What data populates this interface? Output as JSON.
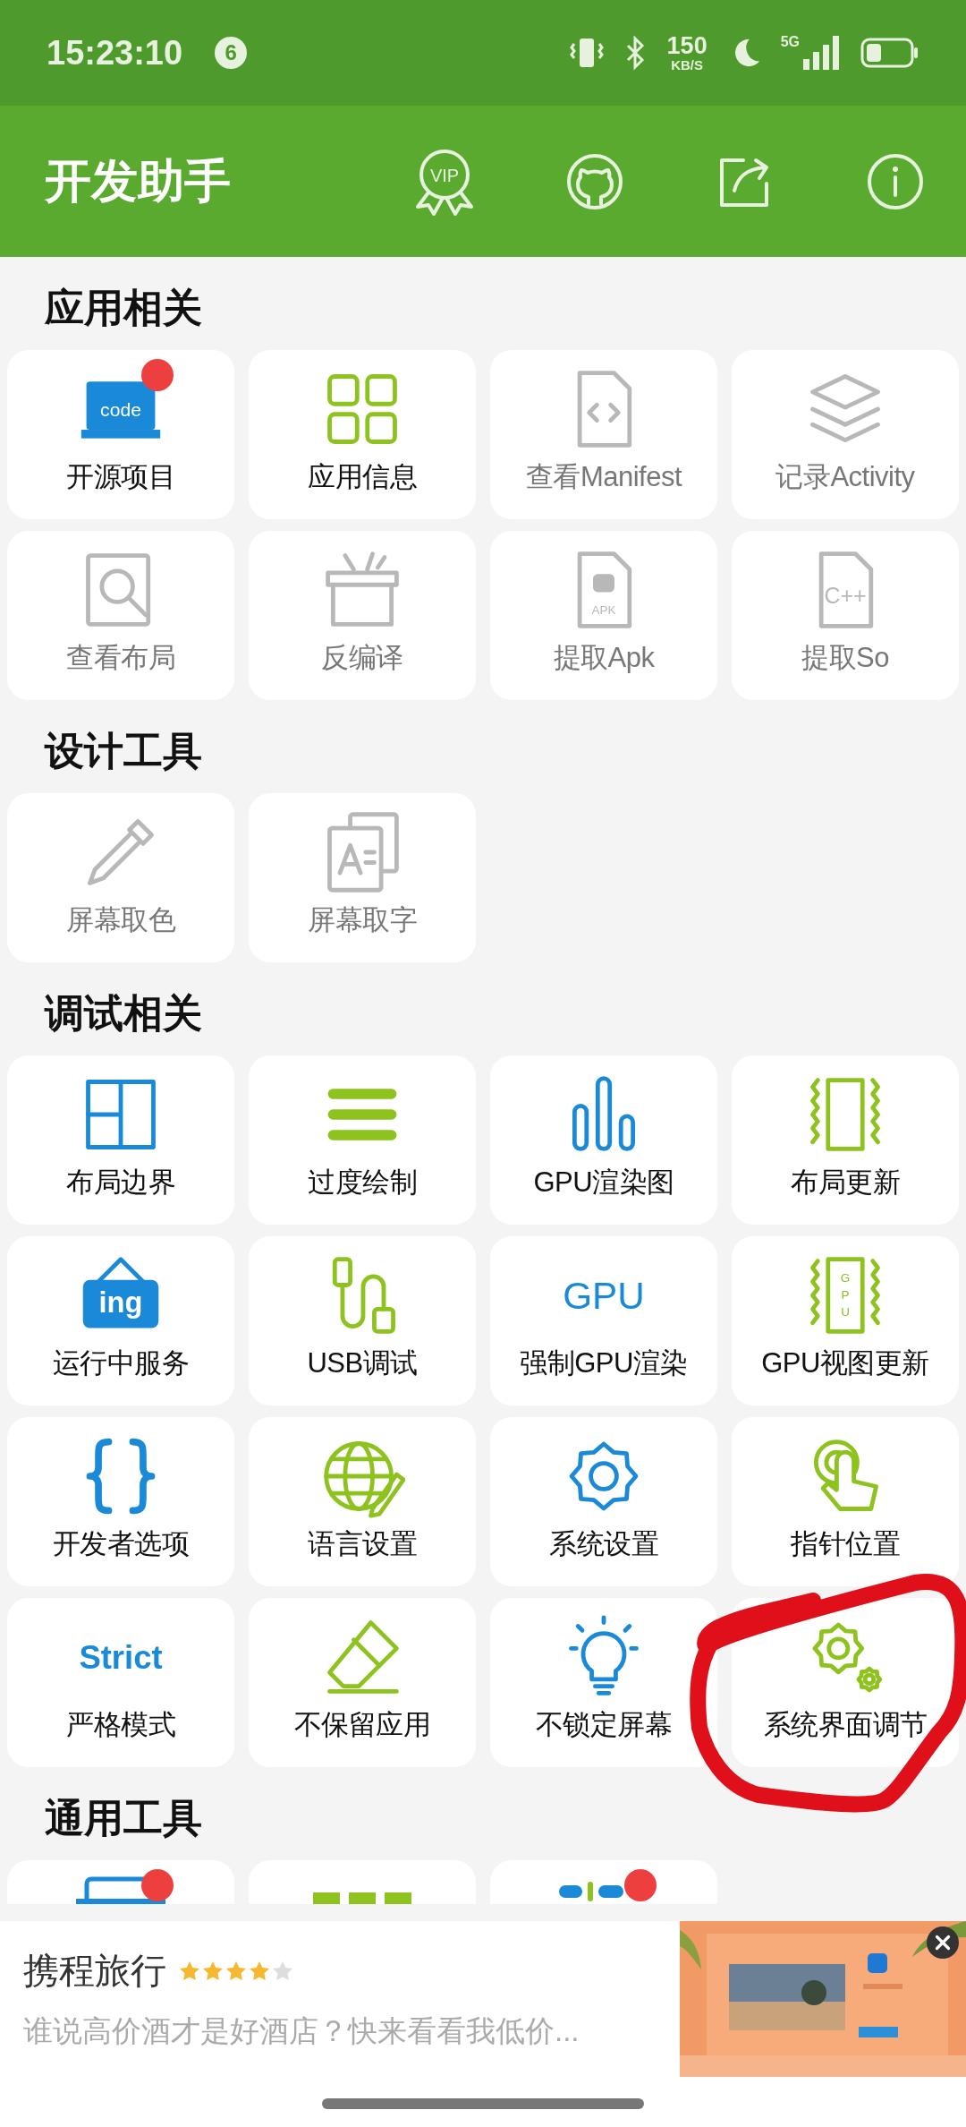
{
  "status_bar": {
    "time": "15:23:10",
    "notification_count": "6",
    "speed": "150",
    "speed_unit": "KB/S",
    "network": "5G"
  },
  "header": {
    "title": "开发助手",
    "vip_label": "VIP"
  },
  "sections": [
    {
      "title": "应用相关",
      "tiles": [
        {
          "label": "开源项目",
          "disabled": false,
          "badge": true,
          "icon_label": "code"
        },
        {
          "label": "应用信息",
          "disabled": false,
          "badge": false
        },
        {
          "label": "查看Manifest",
          "disabled": true,
          "badge": false
        },
        {
          "label": "记录Activity",
          "disabled": true,
          "badge": false
        },
        {
          "label": "查看布局",
          "disabled": true,
          "badge": false
        },
        {
          "label": "反编译",
          "disabled": true,
          "badge": false
        },
        {
          "label": "提取Apk",
          "disabled": true,
          "badge": false,
          "icon_label": "APK"
        },
        {
          "label": "提取So",
          "disabled": true,
          "badge": false,
          "icon_label": "C++"
        }
      ]
    },
    {
      "title": "设计工具",
      "tiles": [
        {
          "label": "屏幕取色",
          "disabled": true,
          "badge": false
        },
        {
          "label": "屏幕取字",
          "disabled": true,
          "badge": false
        }
      ]
    },
    {
      "title": "调试相关",
      "tiles": [
        {
          "label": "布局边界",
          "disabled": false,
          "badge": false
        },
        {
          "label": "过度绘制",
          "disabled": false,
          "badge": false
        },
        {
          "label": "GPU渲染图",
          "disabled": false,
          "badge": false
        },
        {
          "label": "布局更新",
          "disabled": false,
          "badge": false
        },
        {
          "label": "运行中服务",
          "disabled": false,
          "badge": false,
          "icon_label": "ing"
        },
        {
          "label": "USB调试",
          "disabled": false,
          "badge": false
        },
        {
          "label": "强制GPU渲染",
          "disabled": false,
          "badge": false,
          "icon_label": "GPU"
        },
        {
          "label": "GPU视图更新",
          "disabled": false,
          "badge": false,
          "icon_label": "GPU"
        },
        {
          "label": "开发者选项",
          "disabled": false,
          "badge": false
        },
        {
          "label": "语言设置",
          "disabled": false,
          "badge": false
        },
        {
          "label": "系统设置",
          "disabled": false,
          "badge": false
        },
        {
          "label": "指针位置",
          "disabled": false,
          "badge": false
        },
        {
          "label": "严格模式",
          "disabled": false,
          "badge": false,
          "icon_label": "Strict"
        },
        {
          "label": "不保留应用",
          "disabled": false,
          "badge": false
        },
        {
          "label": "不锁定屏幕",
          "disabled": false,
          "badge": false
        },
        {
          "label": "系统界面调节",
          "disabled": false,
          "badge": false
        }
      ]
    },
    {
      "title": "通用工具",
      "tiles": [
        {
          "badge": true
        },
        {
          "badge": false
        },
        {
          "badge": true
        }
      ]
    }
  ],
  "ad": {
    "title": "携程旅行",
    "stars": 4,
    "description": "谁说高价酒才是好酒店？快来看看我低价..."
  }
}
